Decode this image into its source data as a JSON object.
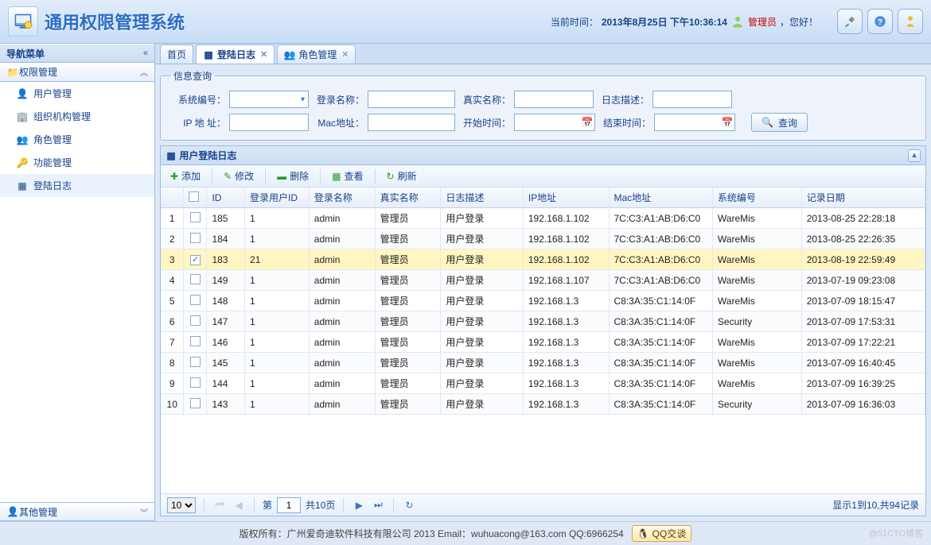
{
  "app_title": "通用权限管理系统",
  "header": {
    "time_label": "当前时间：",
    "time_value": "2013年8月25日 下午10:36:14",
    "user_name": "管理员",
    "greeting": "，您好！"
  },
  "sidebar": {
    "title": "导航菜单",
    "section1_title": "权限管理",
    "items": [
      {
        "label": "用户管理",
        "icon": "user"
      },
      {
        "label": "组织机构管理",
        "icon": "org"
      },
      {
        "label": "角色管理",
        "icon": "role"
      },
      {
        "label": "功能管理",
        "icon": "func"
      },
      {
        "label": "登陆日志",
        "icon": "log",
        "active": true
      }
    ],
    "section2_title": "其他管理"
  },
  "tabs": [
    {
      "label": "首页",
      "closable": false,
      "icon": ""
    },
    {
      "label": "登陆日志",
      "closable": true,
      "icon": "log",
      "active": true
    },
    {
      "label": "角色管理",
      "closable": true,
      "icon": "role"
    }
  ],
  "filter": {
    "legend": "信息查询",
    "fields": {
      "sys_no": "系统编号：",
      "login_name": "登录名称：",
      "real_name": "真实名称：",
      "log_desc": "日志描述：",
      "ip": "IP 地 址：",
      "mac": "Mac地址：",
      "start": "开始时间：",
      "end": "结束时间："
    },
    "search_btn": "查询"
  },
  "grid": {
    "title": "用户登陆日志",
    "toolbar": {
      "add": "添加",
      "edit": "修改",
      "del": "删除",
      "view": "查看",
      "refresh": "刷新"
    },
    "columns": [
      "",
      "",
      "ID",
      "登录用户ID",
      "登录名称",
      "真实名称",
      "日志描述",
      "IP地址",
      "Mac地址",
      "系统编号",
      "记录日期"
    ],
    "rows": [
      {
        "n": 1,
        "chk": false,
        "id": "185",
        "uid": "1",
        "lname": "admin",
        "rname": "管理员",
        "desc": "用户登录",
        "ip": "192.168.1.102",
        "mac": "7C:C3:A1:AB:D6:C0",
        "sys": "WareMis",
        "date": "2013-08-25 22:28:18"
      },
      {
        "n": 2,
        "chk": false,
        "id": "184",
        "uid": "1",
        "lname": "admin",
        "rname": "管理员",
        "desc": "用户登录",
        "ip": "192.168.1.102",
        "mac": "7C:C3:A1:AB:D6:C0",
        "sys": "WareMis",
        "date": "2013-08-25 22:26:35"
      },
      {
        "n": 3,
        "chk": true,
        "sel": true,
        "id": "183",
        "uid": "21",
        "lname": "admin",
        "rname": "管理员",
        "desc": "用户登录",
        "ip": "192.168.1.102",
        "mac": "7C:C3:A1:AB:D6:C0",
        "sys": "WareMis",
        "date": "2013-08-19 22:59:49"
      },
      {
        "n": 4,
        "chk": false,
        "id": "149",
        "uid": "1",
        "lname": "admin",
        "rname": "管理员",
        "desc": "用户登录",
        "ip": "192.168.1.107",
        "mac": "7C:C3:A1:AB:D6:C0",
        "sys": "WareMis",
        "date": "2013-07-19 09:23:08"
      },
      {
        "n": 5,
        "chk": false,
        "id": "148",
        "uid": "1",
        "lname": "admin",
        "rname": "管理员",
        "desc": "用户登录",
        "ip": "192.168.1.3",
        "mac": "C8:3A:35:C1:14:0F",
        "sys": "WareMis",
        "date": "2013-07-09 18:15:47"
      },
      {
        "n": 6,
        "chk": false,
        "id": "147",
        "uid": "1",
        "lname": "admin",
        "rname": "管理员",
        "desc": "用户登录",
        "ip": "192.168.1.3",
        "mac": "C8:3A:35:C1:14:0F",
        "sys": "Security",
        "date": "2013-07-09 17:53:31"
      },
      {
        "n": 7,
        "chk": false,
        "id": "146",
        "uid": "1",
        "lname": "admin",
        "rname": "管理员",
        "desc": "用户登录",
        "ip": "192.168.1.3",
        "mac": "C8:3A:35:C1:14:0F",
        "sys": "WareMis",
        "date": "2013-07-09 17:22:21"
      },
      {
        "n": 8,
        "chk": false,
        "id": "145",
        "uid": "1",
        "lname": "admin",
        "rname": "管理员",
        "desc": "用户登录",
        "ip": "192.168.1.3",
        "mac": "C8:3A:35:C1:14:0F",
        "sys": "WareMis",
        "date": "2013-07-09 16:40:45"
      },
      {
        "n": 9,
        "chk": false,
        "id": "144",
        "uid": "1",
        "lname": "admin",
        "rname": "管理员",
        "desc": "用户登录",
        "ip": "192.168.1.3",
        "mac": "C8:3A:35:C1:14:0F",
        "sys": "WareMis",
        "date": "2013-07-09 16:39:25"
      },
      {
        "n": 10,
        "chk": false,
        "id": "143",
        "uid": "1",
        "lname": "admin",
        "rname": "管理员",
        "desc": "用户登录",
        "ip": "192.168.1.3",
        "mac": "C8:3A:35:C1:14:0F",
        "sys": "Security",
        "date": "2013-07-09 16:36:03"
      }
    ]
  },
  "pager": {
    "page_size": "10",
    "page_label_pre": "第",
    "page_value": "1",
    "page_label_post": "共10页",
    "info": "显示1到10,共94记录"
  },
  "footer": {
    "copyright": "版权所有：广州爱奇迪软件科技有限公司 2013 Email：wuhuacong@163.com QQ:6966254",
    "qq": "QQ交谈",
    "watermark": "@51CTO博客"
  }
}
